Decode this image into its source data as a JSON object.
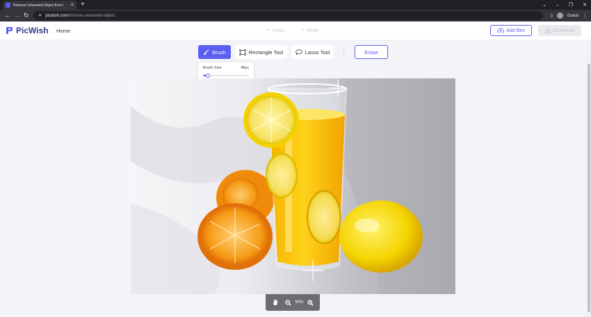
{
  "browser": {
    "tab_title": "Remove Unwanted Object from I",
    "url_host": "picwish.com",
    "url_path": "/remove-unwanted-object",
    "profile": "Guest"
  },
  "header": {
    "brand": "PicWish",
    "nav_home": "Home",
    "undo_label": "Undo",
    "redo_label": "Redo",
    "add_files_label": "Add files",
    "download_label": "Download"
  },
  "tools": {
    "brush_label": "Brush",
    "rectangle_label": "Rectangle Tool",
    "lasso_label": "Lasso Tool",
    "erase_label": "Erase"
  },
  "brush_panel": {
    "label": "Brush Size",
    "value": "48px",
    "slider_level": 0.1
  },
  "zoom": {
    "level": "90%"
  },
  "colors": {
    "accent": "#5b5ef0",
    "brand_text": "#2e3a8c"
  }
}
